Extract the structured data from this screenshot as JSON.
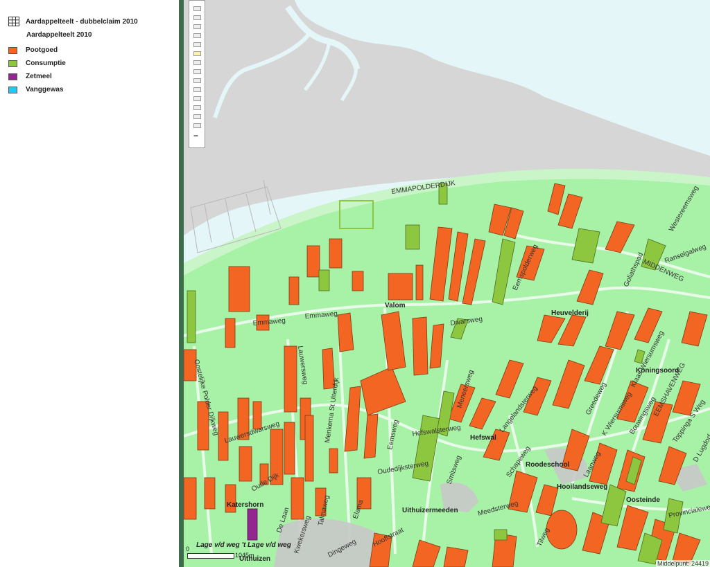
{
  "legend": {
    "layer_dubbel": "Aardappelteelt - dubbelclaim 2010",
    "layer_title": "Aardappelteelt 2010",
    "items": [
      {
        "label": "Pootgoed",
        "color": "#f26522"
      },
      {
        "label": "Consumptie",
        "color": "#8dc63f"
      },
      {
        "label": "Zetmeel",
        "color": "#92278f"
      },
      {
        "label": "Vanggewas",
        "color": "#29c5f6"
      }
    ]
  },
  "colors": {
    "sea": "#e4f6f8",
    "mudflat": "#d6d6d6",
    "land": "#a8f2a8",
    "dike_strip": "#c9f5c9",
    "road": "#e8fbe8",
    "built": "#c8c8c8"
  },
  "map": {
    "roads": {
      "emmapolderdijk": "EMMAPOLDERDIJK",
      "westereemsweg": "Westereemsweg",
      "ranselgalweg": "Ranselgalweg",
      "middenweg": "MIDDENWEG",
      "goliathspad": "Goliathspad",
      "eemspolderweg": "Eemspolderweg",
      "emmaweg_1": "Emmaweg",
      "emmaweg_2": "Emmaweg",
      "dwarsweg": "Dwarsweg",
      "heuvelderij": "Heuvelderij",
      "klaas_wiersumsweg": "Klaas Wiersumsweg",
      "lauwersweg": "Lauwersweg",
      "menkema_st_uiterdijk": "Menkema St Uiterdijk",
      "oostelijke_polder_dijkweg": "Oostelijke Polder Dijkweg",
      "lauwersdwarsweg": "Lauwersdwarsweg",
      "eemsweg": "Eemsweg",
      "hefswalsterweg": "Hefswalsterweg",
      "meneersweg": "Meneersweg",
      "langelandsterweg": "Langelandsterweg",
      "greedeweg": "Greedeweg",
      "k_wiersumsweg": "K Wiersumsweg",
      "bouwingsweg": "Bouwingsweg",
      "eemshavenweg": "EEMSHAVENWEG",
      "toppinga_s_weg": "Toppinga S Weg",
      "d_lugdorf": "D Lugdorf",
      "oude_dijk": "Oude Dijk",
      "de_laan": "De Laan",
      "talmaweg": "Talmaweg",
      "oudedijksterweg": "Oudedijksterweg",
      "smitsweg": "Smitsweg",
      "schapeweg": "Schapeweg",
      "laanweg": "Laanweg",
      "hoillandseweg": "Hooilandseweg",
      "provincialeweg": "Provincialeweg",
      "meedsterweg": "Meedsterweg",
      "tilweg": "Tilweg",
      "kwekersweg": "Kwekersweg",
      "dingeweg": "Dingeweg",
      "hooflstraat": "Hooflstraat",
      "elama": "Elama",
      "lage_vd_weg": "Lage v/d weg 't Lage v/d weg"
    },
    "places": {
      "valom": "Valom",
      "koningsoord": "Koningsoord",
      "hefswal": "Hefswal",
      "roodeschool": "Roodeschool",
      "oosteinde": "Oosteinde",
      "katershorn": "Katershorn",
      "uithuizermeeden": "Uithuizermeeden",
      "uithuizen": "Uithuizen"
    },
    "scale": {
      "zero": "0",
      "distance": "1045m"
    },
    "coord_readout": "Middelpunt: 24419"
  }
}
